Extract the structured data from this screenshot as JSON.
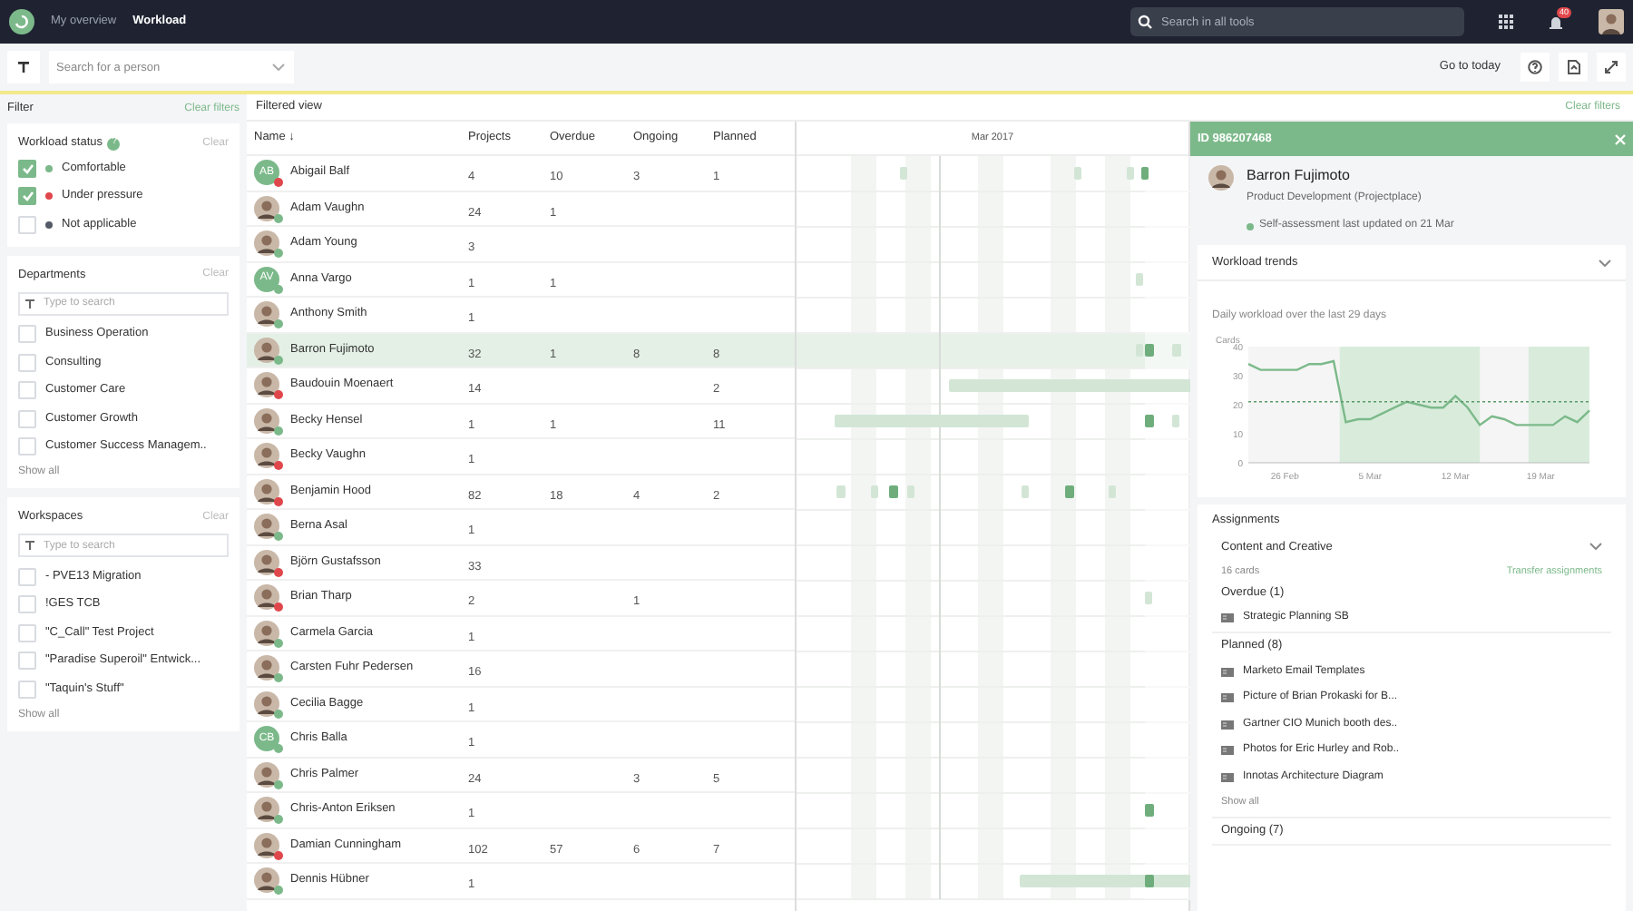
{
  "top_nav": {
    "tabs": [
      {
        "label": "My overview",
        "selected": false
      },
      {
        "label": "Workload",
        "selected": true
      }
    ],
    "search": {
      "placeholder": "Search in all tools"
    },
    "notification_count": "40"
  },
  "toolbar": {
    "person_search": {
      "placeholder": "Search for a person"
    },
    "go_to_today": "Go to today"
  },
  "filter": {
    "title": "Filter",
    "clear_all": "Clear filters",
    "sections": [
      {
        "title": "Workload status",
        "help": "?",
        "clear": "Clear",
        "items": [
          {
            "label": "Comfortable",
            "checked": true,
            "color": "#7cb98a"
          },
          {
            "label": "Under pressure",
            "checked": true,
            "color": "#e0474c"
          },
          {
            "label": "Not applicable",
            "checked": false,
            "color": "#555b66"
          }
        ]
      },
      {
        "title": "Departments",
        "clear": "Clear",
        "search": {
          "placeholder": "Type to search"
        },
        "items": [
          {
            "label": "Business Operation",
            "checked": false
          },
          {
            "label": "Consulting",
            "checked": false
          },
          {
            "label": "Customer Care",
            "checked": false
          },
          {
            "label": "Customer Growth",
            "checked": false
          },
          {
            "label": "Customer Success Managem..",
            "checked": false
          }
        ],
        "show_all": "Show all"
      },
      {
        "title": "Workspaces",
        "clear": "Clear",
        "search": {
          "placeholder": "Type to search"
        },
        "items": [
          {
            "label": "- PVE13 Migration",
            "checked": false
          },
          {
            "label": "!GES TCB",
            "checked": false
          },
          {
            "label": "\"C_Call\" Test Project",
            "checked": false
          },
          {
            "label": "\"Paradise Superoil\" Entwick...",
            "checked": false
          },
          {
            "label": "\"Taquin's Stuff\"",
            "checked": false
          }
        ],
        "show_all": "Show all"
      }
    ]
  },
  "view": {
    "title": "Filtered view",
    "clear": "Clear filters",
    "timeline_month": "Mar 2017"
  },
  "table": {
    "columns": [
      "Name ↓",
      "Projects",
      "Overdue",
      "Ongoing",
      "Planned"
    ],
    "rows": [
      {
        "initials": "AB",
        "color": "#e0474c",
        "selected": false,
        "cells": [
          "Abigail Balf",
          "4",
          "10",
          "3",
          "1"
        ]
      },
      {
        "color": "#7cb98a",
        "selected": false,
        "cells": [
          "Adam Vaughn",
          "24",
          "1",
          "",
          ""
        ]
      },
      {
        "color": "#7cb98a",
        "selected": false,
        "cells": [
          "Adam Young",
          "3",
          "",
          "",
          ""
        ]
      },
      {
        "initials": "AV",
        "color": "#7cb98a",
        "selected": false,
        "cells": [
          "Anna Vargo",
          "1",
          "1",
          "",
          ""
        ]
      },
      {
        "color": "#7cb98a",
        "selected": false,
        "cells": [
          "Anthony Smith",
          "1",
          "",
          "",
          ""
        ]
      },
      {
        "color": "#7cb98a",
        "selected": true,
        "cells": [
          "Barron Fujimoto",
          "32",
          "1",
          "8",
          "8"
        ]
      },
      {
        "color": "#e0474c",
        "selected": false,
        "cells": [
          "Baudouin Moenaert",
          "14",
          "",
          "",
          "2"
        ]
      },
      {
        "color": "#7cb98a",
        "selected": false,
        "cells": [
          "Becky Hensel",
          "1",
          "1",
          "",
          "11"
        ]
      },
      {
        "color": "#e0474c",
        "selected": false,
        "cells": [
          "Becky Vaughn",
          "1",
          "",
          "",
          ""
        ]
      },
      {
        "color": "#e0474c",
        "selected": false,
        "cells": [
          "Benjamin Hood",
          "82",
          "18",
          "4",
          "2"
        ]
      },
      {
        "color": "#7cb98a",
        "selected": false,
        "cells": [
          "Berna Asal",
          "1",
          "",
          "",
          ""
        ]
      },
      {
        "color": "#e0474c",
        "selected": false,
        "cells": [
          "Björn Gustafsson",
          "33",
          "",
          "",
          ""
        ]
      },
      {
        "color": "#e0474c",
        "selected": false,
        "cells": [
          "Brian Tharp",
          "2",
          "",
          "1",
          ""
        ]
      },
      {
        "color": "#7cb98a",
        "selected": false,
        "cells": [
          "Carmela Garcia",
          "1",
          "",
          "",
          ""
        ]
      },
      {
        "color": "#7cb98a",
        "selected": false,
        "cells": [
          "Carsten Fuhr Pedersen",
          "16",
          "",
          "",
          ""
        ]
      },
      {
        "color": "#7cb98a",
        "selected": false,
        "cells": [
          "Cecilia Bagge",
          "1",
          "",
          "",
          ""
        ]
      },
      {
        "initials": "CB",
        "color": "#7cb98a",
        "selected": false,
        "cells": [
          "Chris Balla",
          "1",
          "",
          "",
          ""
        ]
      },
      {
        "color": "#7cb98a",
        "selected": false,
        "cells": [
          "Chris Palmer",
          "24",
          "",
          "3",
          "5"
        ]
      },
      {
        "color": "#7cb98a",
        "selected": false,
        "cells": [
          "Chris-Anton Eriksen",
          "1",
          "",
          "",
          ""
        ]
      },
      {
        "color": "#e0474c",
        "selected": false,
        "cells": [
          "Damian Cunningham",
          "102",
          "57",
          "6",
          "7"
        ]
      },
      {
        "color": "#7cb98a",
        "selected": false,
        "cells": [
          "Dennis Hübner",
          "1",
          "",
          "",
          ""
        ]
      }
    ]
  },
  "detail": {
    "id": "ID 986207468",
    "name": "Barron Fujimoto",
    "department": "Product Development (Projectplace)",
    "assessment": "Self-assessment last updated on 21 Mar",
    "trends": {
      "title": "Workload trends",
      "subtitle": "Daily workload over the last 29 days",
      "expanded": true,
      "chart_data": {
        "type": "line",
        "ylabel": "Cards",
        "categories": [
          null,
          null,
          null,
          "26 Feb",
          null,
          null,
          null,
          null,
          null,
          null,
          "5 Mar",
          null,
          null,
          null,
          null,
          null,
          null,
          "12 Mar",
          null,
          null,
          null,
          null,
          null,
          null,
          "19 Mar",
          null,
          null,
          null,
          null
        ],
        "ylim": [
          0,
          40
        ],
        "yticks": [
          0,
          10,
          20,
          30,
          40
        ],
        "series": [
          {
            "color": "#7cb98a",
            "values": [
              34,
              32,
              32,
              32,
              32,
              34,
              34,
              35,
              14,
              15,
              15,
              17,
              19,
              21,
              20,
              19,
              19,
              23,
              19,
              13,
              16,
              15,
              13,
              13,
              13,
              13,
              16,
              14,
              18
            ]
          },
          {
            "color": "#5a9a68",
            "line_style": "dashed",
            "values": [
              21,
              21,
              21,
              21,
              21,
              21,
              21,
              21,
              21,
              21,
              21,
              21,
              21,
              21,
              21,
              21,
              21,
              21,
              21,
              21,
              21,
              21,
              21,
              21,
              21,
              21,
              21,
              21,
              21
            ]
          }
        ]
      }
    },
    "assignments": {
      "title": "Assignments",
      "group": "Content and Creative",
      "count": "16 cards",
      "transfer": "Transfer assignments",
      "sections": [
        {
          "title": "Overdue (1)",
          "items": [
            "Strategic Planning SB"
          ]
        },
        {
          "title": "Planned (8)",
          "items": [
            "Marketo Email Templates",
            "Picture of Brian Prokaski for B...",
            "Gartner CIO Munich booth des..",
            "Photos for Eric Hurley and Rob..",
            "Innotas Architecture Diagram"
          ],
          "show_all": "Show all"
        },
        {
          "title": "Ongoing (7)"
        }
      ]
    }
  }
}
